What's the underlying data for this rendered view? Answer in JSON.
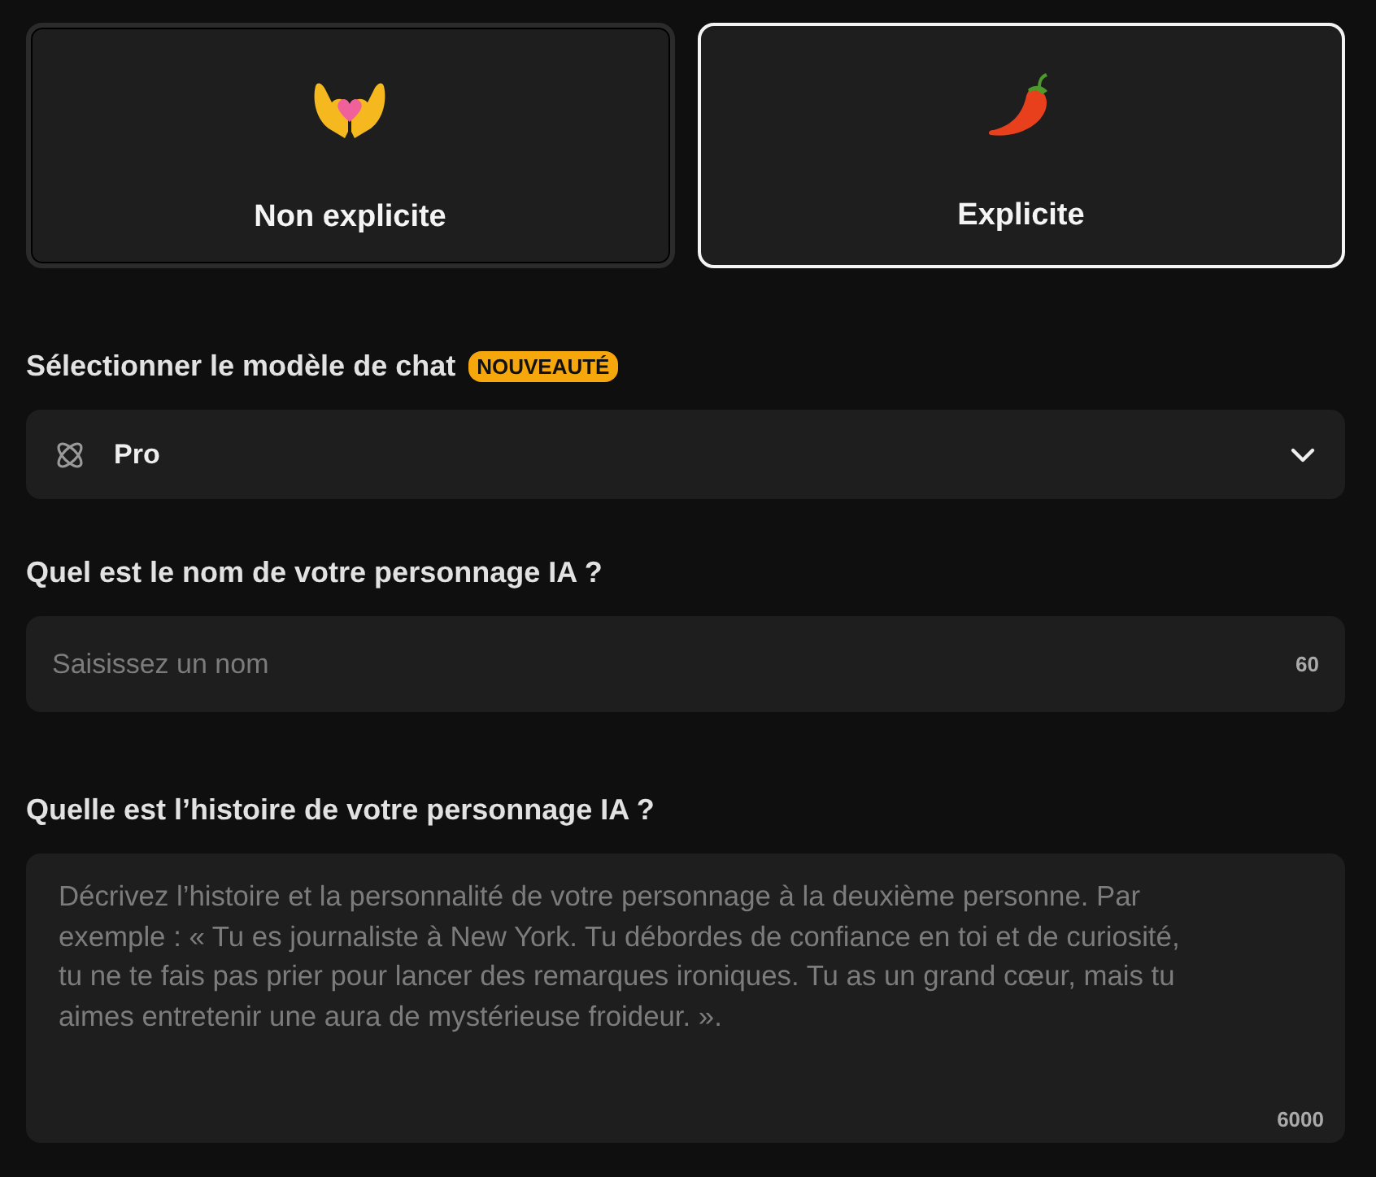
{
  "content_types": [
    {
      "label": "Non explicite",
      "kind": "hands",
      "selected": false
    },
    {
      "label": "Explicite",
      "kind": "pepper",
      "selected": true
    }
  ],
  "model": {
    "label": "Sélectionner le modèle de chat",
    "badge": "NOUVEAUTÉ",
    "value": "Pro"
  },
  "name": {
    "label": "Quel est le nom de votre personnage IA ?",
    "placeholder": "Saisissez un nom",
    "counter": "60"
  },
  "story": {
    "label": "Quelle est l’histoire de votre personnage IA ?",
    "placeholder": "Décrivez l’histoire et la personnalité de votre personnage à la deuxième personne. Par exemple : « Tu es journaliste à New York. Tu débordes de confiance en toi et de curiosité, tu ne te fais pas prier pour lancer des remarques ironiques. Tu as un grand cœur, mais tu aimes entretenir une aura de mystérieuse froideur. ».",
    "counter": "6000"
  }
}
